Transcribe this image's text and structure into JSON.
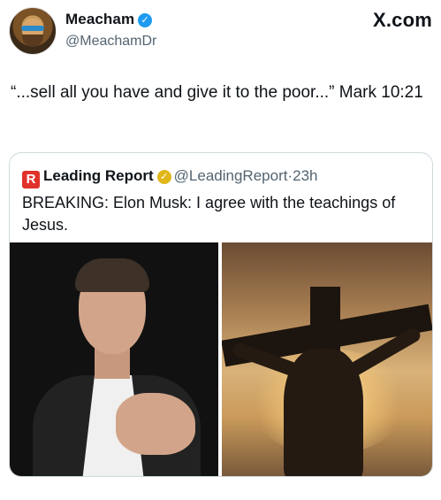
{
  "author": {
    "name": "Meacham",
    "handle": "@MeachamDr",
    "verified_icon": "verified-check-icon",
    "avatar_icon": "avatar-illustration"
  },
  "site_logo": "X.com",
  "tweet": {
    "text": "“...sell all you have and give it to the poor...” Mark 10:21"
  },
  "quote": {
    "logo_letter": "R",
    "name": "Leading Report",
    "badge_icon": "gold-verified-badge-icon",
    "handle": "@LeadingReport",
    "separator": "·",
    "time": "23h",
    "text": "BREAKING: Elon Musk: I agree with the teachings of Jesus."
  },
  "colors": {
    "verified_blue": "#1d9bf0",
    "gold_badge": "#e2b719",
    "leading_report_red": "#e0312b",
    "secondary_text": "#536471"
  }
}
